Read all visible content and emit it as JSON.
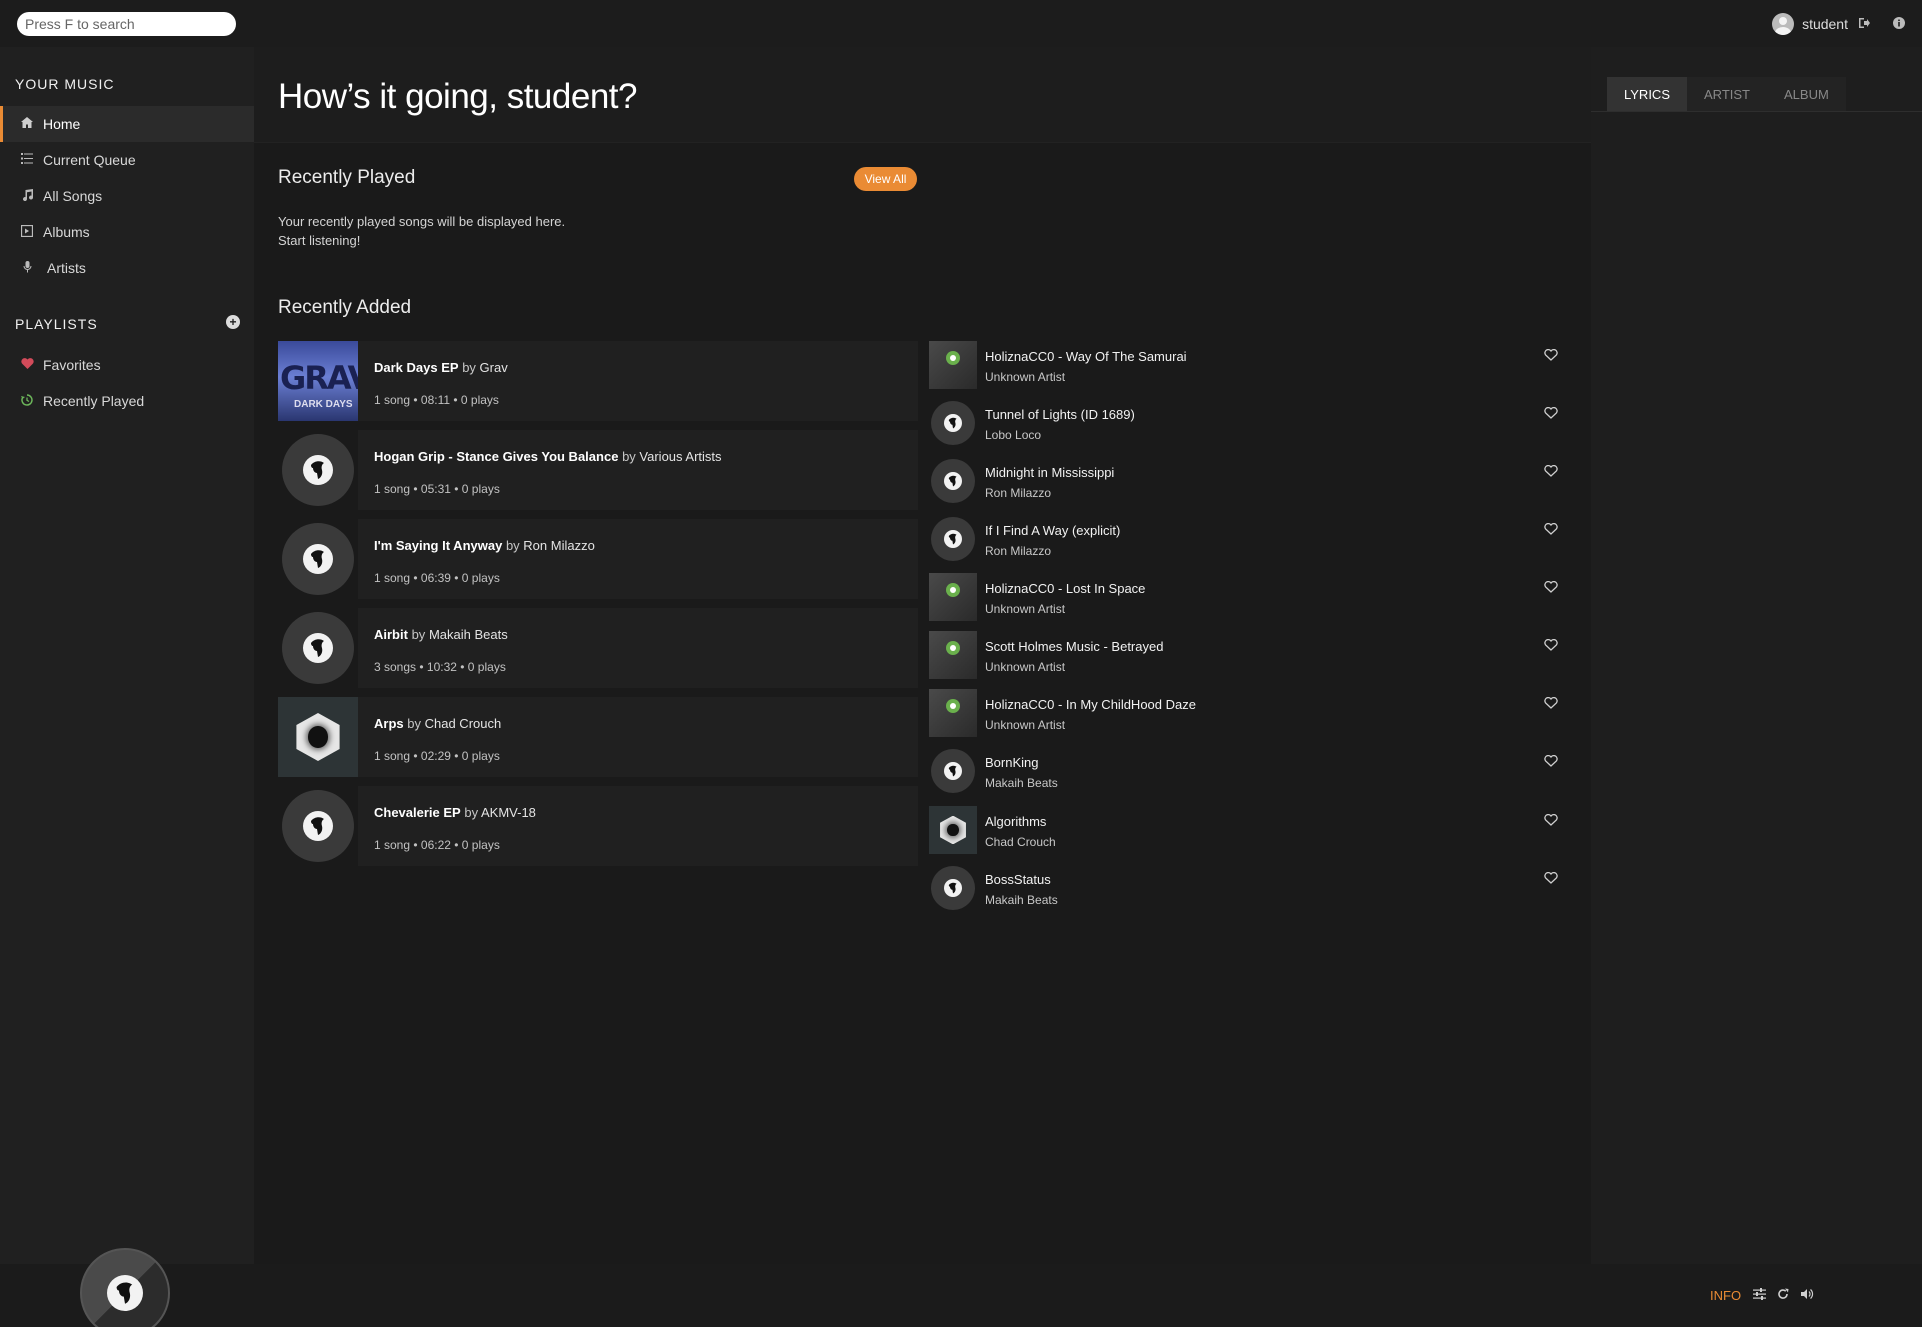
{
  "search": {
    "placeholder": "Press F to search"
  },
  "user": {
    "name": "student"
  },
  "sidebar": {
    "your_music_title": "YOUR MUSIC",
    "items": [
      {
        "label": "Home",
        "icon": "home-icon"
      },
      {
        "label": "Current Queue",
        "icon": "list-icon"
      },
      {
        "label": "All Songs",
        "icon": "music-note-icon"
      },
      {
        "label": "Albums",
        "icon": "album-icon"
      },
      {
        "label": "Artists",
        "icon": "microphone-icon"
      }
    ],
    "playlists_title": "PLAYLISTS",
    "playlists": [
      {
        "label": "Favorites",
        "icon": "heart-icon",
        "color": "#d24b5a"
      },
      {
        "label": "Recently Played",
        "icon": "history-icon",
        "color": "#6cb65a"
      }
    ]
  },
  "main": {
    "greeting": "How’s it going, student?",
    "recently_played": {
      "title": "Recently Played",
      "view_all": "View All",
      "empty_line1": "Your recently played songs will be displayed here.",
      "empty_line2": "Start listening!"
    },
    "recently_added": {
      "title": "Recently Added",
      "albums": [
        {
          "name": "Dark Days EP",
          "by": "by",
          "artist": "Grav",
          "meta": "1 song • 08:11 • 0 plays",
          "cover": "grav"
        },
        {
          "name": "Hogan Grip - Stance Gives You Balance",
          "by": "by",
          "artist": "Various Artists",
          "meta": "1 song • 05:31 • 0 plays",
          "cover": "disc"
        },
        {
          "name": "I'm Saying It Anyway",
          "by": "by",
          "artist": "Ron Milazzo",
          "meta": "1 song • 06:39 • 0 plays",
          "cover": "disc"
        },
        {
          "name": "Airbit",
          "by": "by",
          "artist": "Makaih Beats",
          "meta": "3 songs • 10:32 • 0 plays",
          "cover": "disc"
        },
        {
          "name": "Arps",
          "by": "by",
          "artist": "Chad Crouch",
          "meta": "1 song • 02:29 • 0 plays",
          "cover": "hex"
        },
        {
          "name": "Chevalerie EP",
          "by": "by",
          "artist": "AKMV-18",
          "meta": "1 song • 06:22 • 0 plays",
          "cover": "disc"
        }
      ],
      "songs": [
        {
          "title": "HoliznaCC0 - Way Of The Samurai",
          "artist": "Unknown Artist",
          "thumb": "audio"
        },
        {
          "title": "Tunnel of Lights (ID 1689)",
          "artist": "Lobo Loco",
          "thumb": "disc"
        },
        {
          "title": "Midnight in Mississippi",
          "artist": "Ron Milazzo",
          "thumb": "disc"
        },
        {
          "title": "If I Find A Way (explicit)",
          "artist": "Ron Milazzo",
          "thumb": "disc"
        },
        {
          "title": "HoliznaCC0 - Lost In Space",
          "artist": "Unknown Artist",
          "thumb": "audio"
        },
        {
          "title": "Scott Holmes Music - Betrayed",
          "artist": "Unknown Artist",
          "thumb": "audio"
        },
        {
          "title": "HoliznaCC0 - In My ChildHood Daze",
          "artist": "Unknown Artist",
          "thumb": "audio"
        },
        {
          "title": "BornKing",
          "artist": "Makaih Beats",
          "thumb": "disc"
        },
        {
          "title": "Algorithms",
          "artist": "Chad Crouch",
          "thumb": "hex"
        },
        {
          "title": "BossStatus",
          "artist": "Makaih Beats",
          "thumb": "disc"
        }
      ]
    }
  },
  "extra": {
    "tabs": [
      "LYRICS",
      "ARTIST",
      "ALBUM"
    ],
    "active_tab": "LYRICS"
  },
  "footer": {
    "info_label": "INFO"
  },
  "colors": {
    "accent": "#ea8b34",
    "background": "#181818",
    "sidebar": "#202020"
  }
}
